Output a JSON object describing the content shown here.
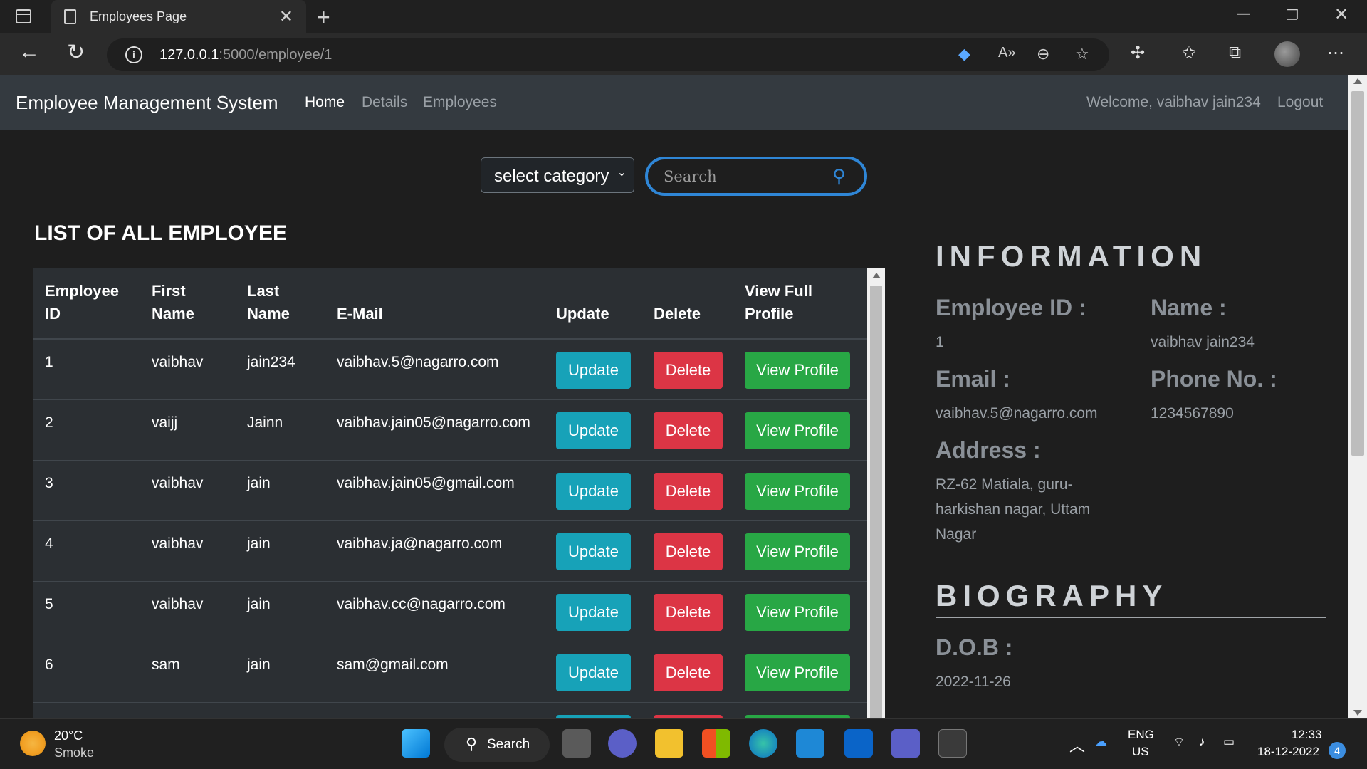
{
  "browser": {
    "tab_title": "Employees Page",
    "url_host": "127.0.0.1",
    "url_path": ":5000/employee/1",
    "icons": [
      "window-icon",
      "new-tab-icon",
      "minimize-icon",
      "restore-icon",
      "close-window-icon",
      "back-icon",
      "reload-icon",
      "info-icon",
      "tag-icon",
      "read-aloud-icon",
      "zoom-out-icon",
      "add-favorite-icon",
      "extensions-icon",
      "favorites-icon",
      "collections-icon",
      "profile-avatar",
      "more-icon"
    ]
  },
  "navbar": {
    "brand": "Employee Management System",
    "links": [
      "Home",
      "Details",
      "Employees"
    ],
    "welcome": "Welcome, vaibhav jain234",
    "logout": "Logout"
  },
  "filter": {
    "category_label": "select category",
    "search_placeholder": "Search"
  },
  "list": {
    "title": "LIST OF ALL EMPLOYEE",
    "headers": {
      "id_line1": "Employee",
      "id_line2": "ID",
      "first_line1": "First",
      "first_line2": "Name",
      "last_line1": "Last",
      "last_line2": "Name",
      "email": "E-Mail",
      "update": "Update",
      "delete": "Delete",
      "view_line1": "View Full",
      "view_line2": "Profile"
    },
    "button_labels": {
      "update": "Update",
      "delete": "Delete",
      "view": "View Profile"
    },
    "rows": [
      {
        "id": "1",
        "first": "vaibhav",
        "last": "jain234",
        "email": "vaibhav.5@nagarro.com"
      },
      {
        "id": "2",
        "first": "vaijj",
        "last": "Jainn",
        "email": "vaibhav.jain05@nagarro.com"
      },
      {
        "id": "3",
        "first": "vaibhav",
        "last": "jain",
        "email": "vaibhav.jain05@gmail.com"
      },
      {
        "id": "4",
        "first": "vaibhav",
        "last": "jain",
        "email": "vaibhav.ja@nagarro.com"
      },
      {
        "id": "5",
        "first": "vaibhav",
        "last": "jain",
        "email": "vaibhav.cc@nagarro.com"
      },
      {
        "id": "6",
        "first": "sam",
        "last": "jain",
        "email": "sam@gmail.com"
      }
    ]
  },
  "info": {
    "heading": "INFORMATION",
    "employee_id_label": "Employee ID :",
    "employee_id": "1",
    "name_label": "Name :",
    "name": "vaibhav jain234",
    "email_label": "Email :",
    "email": "vaibhav.5@nagarro.com",
    "phone_label": "Phone No. :",
    "phone": "1234567890",
    "address_label": "Address :",
    "address_line1": "RZ-62 Matiala, guru-",
    "address_line2": "harkishan nagar, Uttam",
    "address_line3": "Nagar"
  },
  "bio": {
    "heading": "BIOGRAPHY",
    "dob_label": "D.O.B :",
    "dob": "2022-11-26"
  },
  "taskbar": {
    "weather_temp": "20°C",
    "weather_condition": "Smoke",
    "search_label": "Search",
    "lang_top": "ENG",
    "lang_bottom": "US",
    "time": "12:33",
    "date": "18-12-2022",
    "notification_count": "4"
  },
  "colors": {
    "navbar": "#343a40",
    "update": "#17a2b8",
    "delete": "#dc3545",
    "view": "#28a745",
    "search_border": "#2f86d6"
  }
}
